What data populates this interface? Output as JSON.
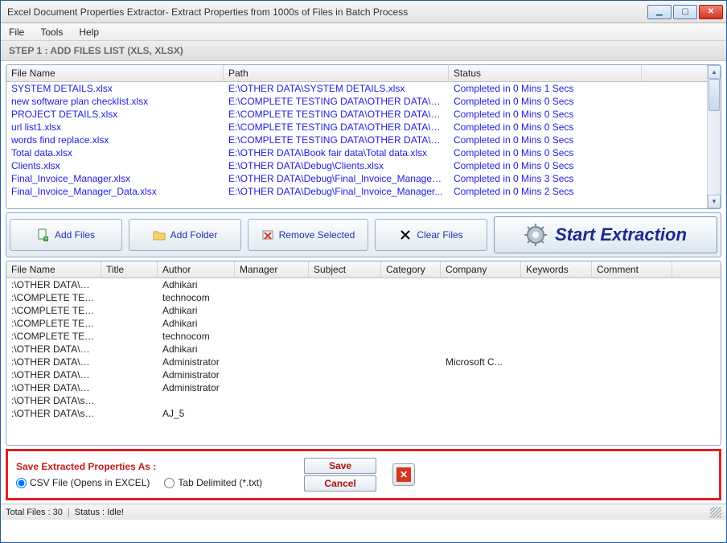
{
  "window": {
    "title": "Excel Document Properties Extractor- Extract Properties from 1000s of Files in Batch Process"
  },
  "menu": {
    "file": "File",
    "tools": "Tools",
    "help": "Help"
  },
  "step_header": "STEP 1 : ADD FILES LIST (XLS, XLSX)",
  "top_columns": {
    "file_name": "File Name",
    "path": "Path",
    "status": "Status"
  },
  "top_rows": [
    {
      "file": "SYSTEM DETAILS.xlsx",
      "path": "E:\\OTHER DATA\\SYSTEM DETAILS.xlsx",
      "status": "Completed in 0 Mins 1 Secs"
    },
    {
      "file": "new software plan checklist.xlsx",
      "path": "E:\\COMPLETE TESTING DATA\\OTHER DATA\\ne...",
      "status": "Completed in 0 Mins 0 Secs"
    },
    {
      "file": "PROJECT DETAILS.xlsx",
      "path": "E:\\COMPLETE TESTING DATA\\OTHER DATA\\PR...",
      "status": "Completed in 0 Mins 0 Secs"
    },
    {
      "file": "url list1.xlsx",
      "path": "E:\\COMPLETE TESTING DATA\\OTHER DATA\\url...",
      "status": "Completed in 0 Mins 0 Secs"
    },
    {
      "file": "words find replace.xlsx",
      "path": "E:\\COMPLETE TESTING DATA\\OTHER DATA\\w...",
      "status": "Completed in 0 Mins 0 Secs"
    },
    {
      "file": "Total data.xlsx",
      "path": "E:\\OTHER DATA\\Book fair data\\Total data.xlsx",
      "status": "Completed in 0 Mins 0 Secs"
    },
    {
      "file": "Clients.xlsx",
      "path": "E:\\OTHER DATA\\Debug\\Clients.xlsx",
      "status": "Completed in 0 Mins 0 Secs"
    },
    {
      "file": "Final_Invoice_Manager.xlsx",
      "path": "E:\\OTHER DATA\\Debug\\Final_Invoice_Manager....",
      "status": "Completed in 0 Mins 3 Secs"
    },
    {
      "file": "Final_Invoice_Manager_Data.xlsx",
      "path": "E:\\OTHER DATA\\Debug\\Final_Invoice_Manager...",
      "status": "Completed in 0 Mins 2 Secs"
    }
  ],
  "toolbar": {
    "add_files": "Add Files",
    "add_folder": "Add Folder",
    "remove_selected": "Remove Selected",
    "clear_files": "Clear Files",
    "start": "Start Extraction"
  },
  "bottom_columns": {
    "file_name": "File Name",
    "title": "Title",
    "author": "Author",
    "manager": "Manager",
    "subject": "Subject",
    "category": "Category",
    "company": "Company",
    "keywords": "Keywords",
    "comment": "Comment"
  },
  "bottom_rows": [
    {
      "file": ":\\OTHER DATA\\SYSTEM D...",
      "title": "",
      "author": "Adhikari",
      "manager": "",
      "subject": "",
      "category": "",
      "company": "",
      "keywords": "",
      "comment": ""
    },
    {
      "file": ":\\COMPLETE TESTING DA...",
      "title": "",
      "author": "technocom",
      "manager": "",
      "subject": "",
      "category": "",
      "company": "",
      "keywords": "",
      "comment": ""
    },
    {
      "file": ":\\COMPLETE TESTING DA...",
      "title": "",
      "author": "Adhikari",
      "manager": "",
      "subject": "",
      "category": "",
      "company": "",
      "keywords": "",
      "comment": ""
    },
    {
      "file": ":\\COMPLETE TESTING DA...",
      "title": "",
      "author": "Adhikari",
      "manager": "",
      "subject": "",
      "category": "",
      "company": "",
      "keywords": "",
      "comment": ""
    },
    {
      "file": ":\\COMPLETE TESTING DA...",
      "title": "",
      "author": "technocom",
      "manager": "",
      "subject": "",
      "category": "",
      "company": "",
      "keywords": "",
      "comment": ""
    },
    {
      "file": ":\\OTHER DATA\\Book fair ...",
      "title": "",
      "author": "Adhikari",
      "manager": "",
      "subject": "",
      "category": "",
      "company": "",
      "keywords": "",
      "comment": ""
    },
    {
      "file": ":\\OTHER DATA\\Debug\\Cli...",
      "title": "",
      "author": "Administrator",
      "manager": "",
      "subject": "",
      "category": "",
      "company": "Microsoft C...",
      "keywords": "",
      "comment": ""
    },
    {
      "file": ":\\OTHER DATA\\Debug\\Fi...",
      "title": "",
      "author": "Administrator",
      "manager": "",
      "subject": "",
      "category": "",
      "company": "",
      "keywords": "",
      "comment": ""
    },
    {
      "file": ":\\OTHER DATA\\Debug\\Fi...",
      "title": "",
      "author": "Administrator",
      "manager": "",
      "subject": "",
      "category": "",
      "company": "",
      "keywords": "",
      "comment": ""
    },
    {
      "file": ":\\OTHER DATA\\software c...",
      "title": "",
      "author": "",
      "manager": "",
      "subject": "",
      "category": "",
      "company": "",
      "keywords": "",
      "comment": ""
    },
    {
      "file": ":\\OTHER DATA\\software c...",
      "title": "",
      "author": "AJ_5",
      "manager": "",
      "subject": "",
      "category": "",
      "company": "",
      "keywords": "",
      "comment": ""
    }
  ],
  "save_panel": {
    "label": "Save Extracted Properties As :",
    "csv": "CSV File (Opens in EXCEL)",
    "tab": "Tab Delimited (*.txt)",
    "save": "Save",
    "cancel": "Cancel"
  },
  "status": {
    "total": "Total Files : 30",
    "idle": "Status :   Idle!"
  }
}
